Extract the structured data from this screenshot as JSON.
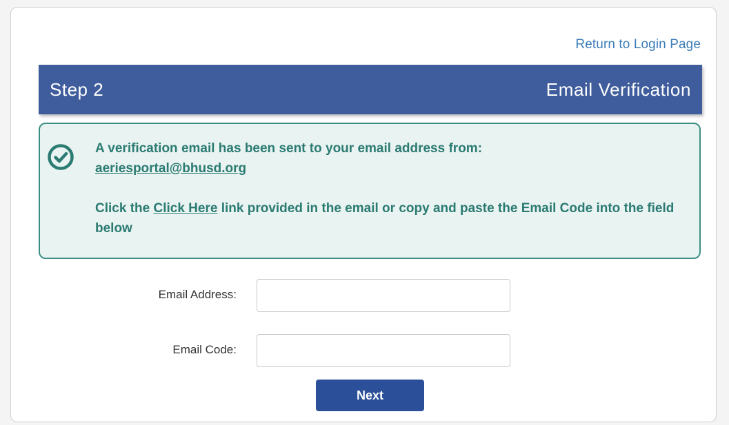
{
  "header": {
    "return_link": "Return to Login Page",
    "step_number": "Step 2",
    "step_title": "Email Verification"
  },
  "notice": {
    "icon": "check-circle-icon",
    "line1": "A verification email has been sent to your email address from:",
    "sender_email": "aeriesportal@bhusd.org",
    "line2_pre": "Click the ",
    "line2_link": "Click Here",
    "line2_post": " link provided in the email or copy and paste the Email Code into the field below",
    "colors": {
      "text": "#2b7b72",
      "border": "#3d8f86",
      "background": "#e9f3f1"
    }
  },
  "form": {
    "email_address_label": "Email Address:",
    "email_address_value": "",
    "email_code_label": "Email Code:",
    "email_code_value": "",
    "next_label": "Next"
  },
  "colors": {
    "header_bg": "#3f5d9c",
    "button_bg": "#2b4f98",
    "link": "#3c7cb8"
  }
}
